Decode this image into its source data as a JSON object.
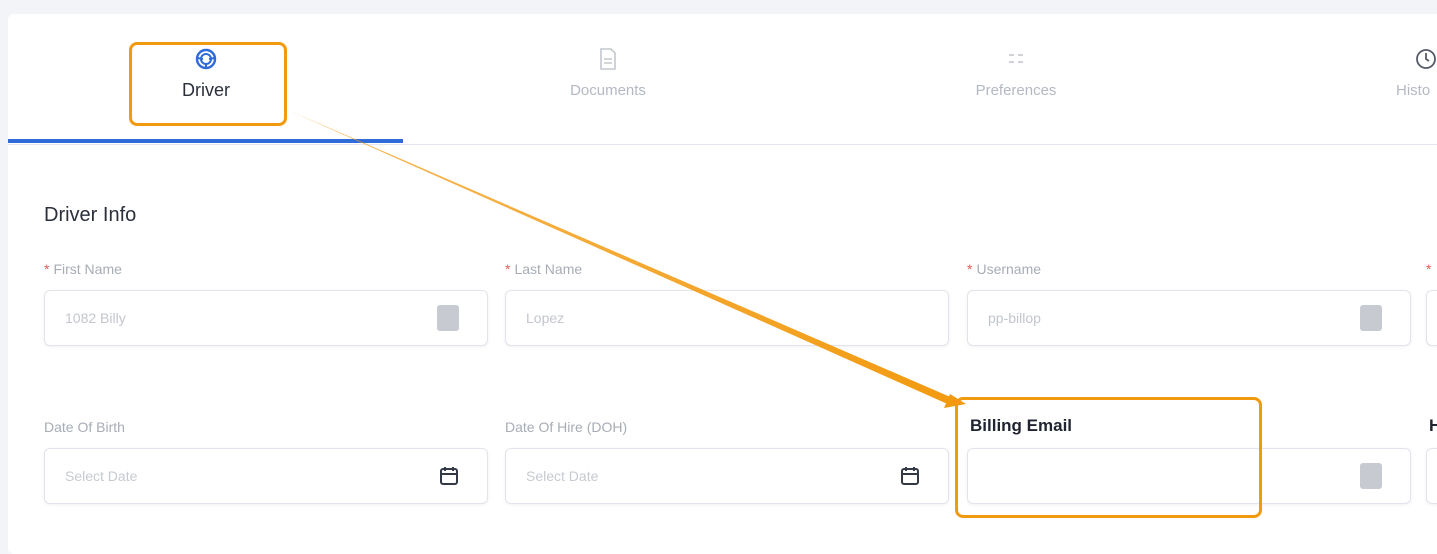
{
  "tabs": [
    {
      "label": "Driver",
      "icon": "steering-wheel-icon",
      "active": true
    },
    {
      "label": "Documents",
      "icon": "document-icon",
      "active": false
    },
    {
      "label": "Preferences",
      "icon": "preferences-icon",
      "active": false
    },
    {
      "label": "Histo",
      "icon": "clock-icon",
      "active": false
    }
  ],
  "section": {
    "title": "Driver Info"
  },
  "fields": {
    "first_name": {
      "label": "First Name",
      "value": "1082 Billy",
      "required": "*"
    },
    "last_name": {
      "label": "Last Name",
      "value": "Lopez",
      "required": "*"
    },
    "username": {
      "label": "Username",
      "value": "pp-billop",
      "required": "*"
    },
    "fourth_required": {
      "required": "*"
    },
    "dob": {
      "label": "Date Of Birth",
      "placeholder": "Select Date"
    },
    "doh": {
      "label": "Date Of Hire (DOH)",
      "placeholder": "Select Date"
    },
    "billing_email": {
      "label": "Billing Email",
      "value": ""
    },
    "fourth_label": {
      "label": "H"
    }
  },
  "colors": {
    "accent": "#2f6bd8",
    "annotation": "#f29a0f",
    "required": "#e25b5b"
  }
}
